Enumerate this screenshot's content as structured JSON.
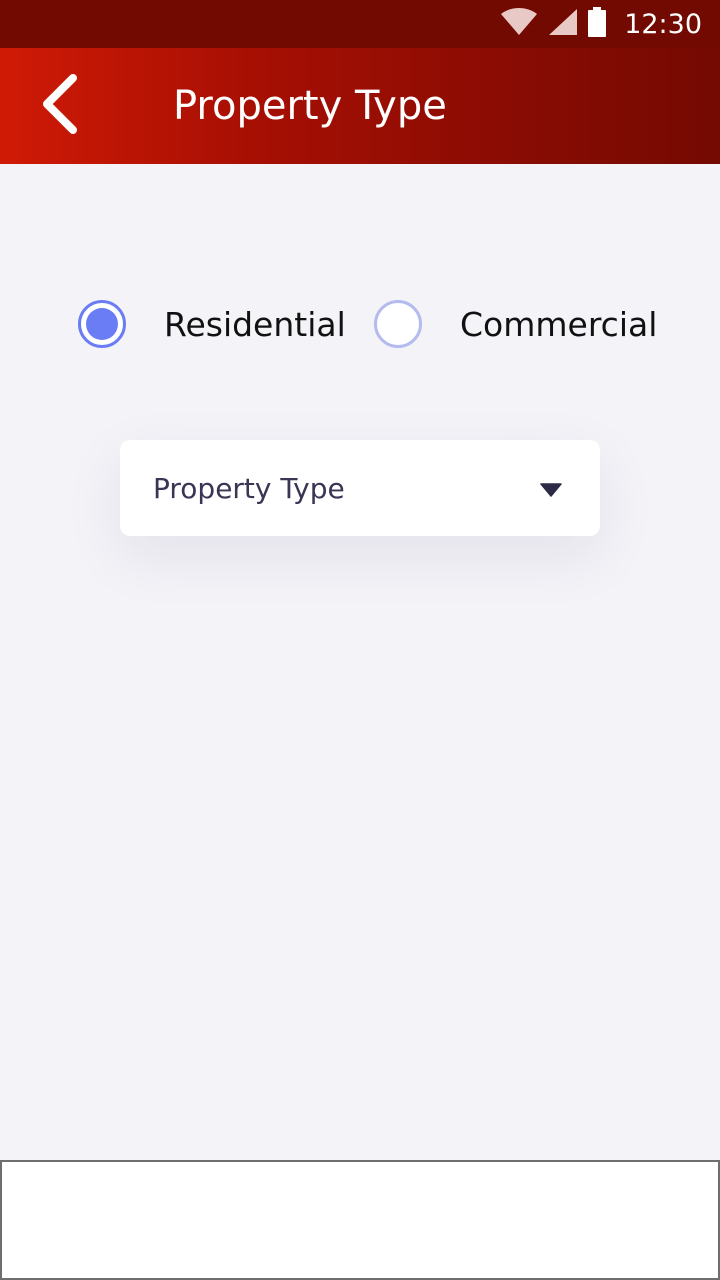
{
  "status_bar": {
    "time": "12:30",
    "icons": [
      "wifi-icon",
      "cellular-signal-icon",
      "battery-icon"
    ]
  },
  "app_bar": {
    "title": "Property Type",
    "back_icon": "chevron-left-icon",
    "gradient_colors": [
      "#d01a06",
      "#740a02"
    ]
  },
  "property_category": {
    "options": [
      {
        "label": "Residential",
        "selected": true
      },
      {
        "label": "Commercial",
        "selected": false
      }
    ],
    "accent_color": "#6a7df5"
  },
  "property_type_dropdown": {
    "selected_value": "Property Type",
    "caret_icon": "caret-down-icon"
  }
}
